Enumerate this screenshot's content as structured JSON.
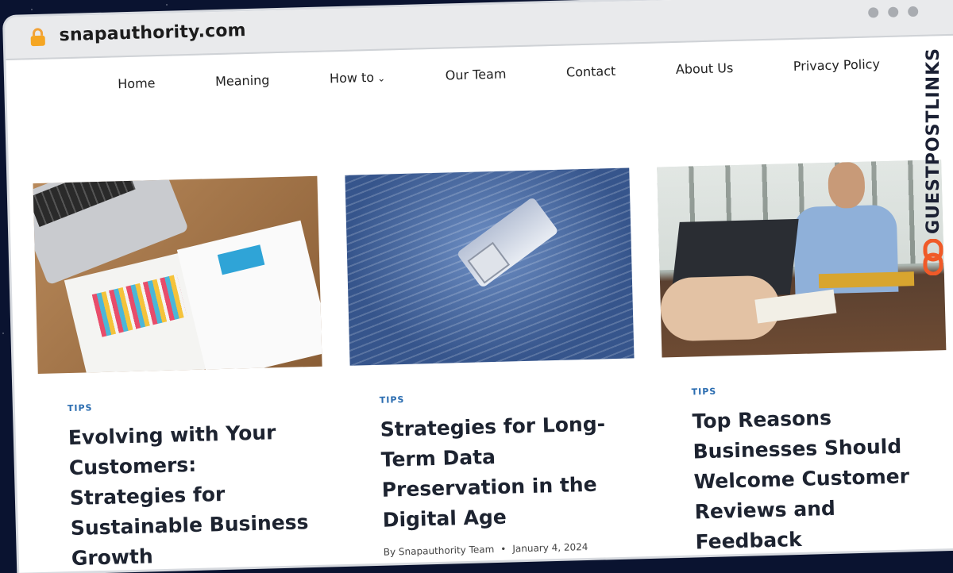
{
  "browser": {
    "url": "snapauthority.com"
  },
  "nav": {
    "items": [
      "Home",
      "Meaning",
      "How to",
      "Our Team",
      "Contact",
      "About Us",
      "Privacy Policy"
    ]
  },
  "posts": [
    {
      "category": "TIPS",
      "title": "Evolving with Your Customers: Strategies for Sustainable Business Growth"
    },
    {
      "category": "TIPS",
      "title": "Strategies for Long-Term Data Preservation in the Digital Age",
      "author": "By Snapauthority Team",
      "date": "January 4, 2024"
    },
    {
      "category": "TIPS",
      "title": "Top Reasons Businesses Should Welcome Customer Reviews and Feedback"
    }
  ],
  "watermark": {
    "text": "GUESTPOSTLINKS"
  },
  "colors": {
    "category": "#2a6cb0",
    "title": "#1d2330",
    "background": "#0a1330",
    "logo_accent": "#f05a28"
  }
}
